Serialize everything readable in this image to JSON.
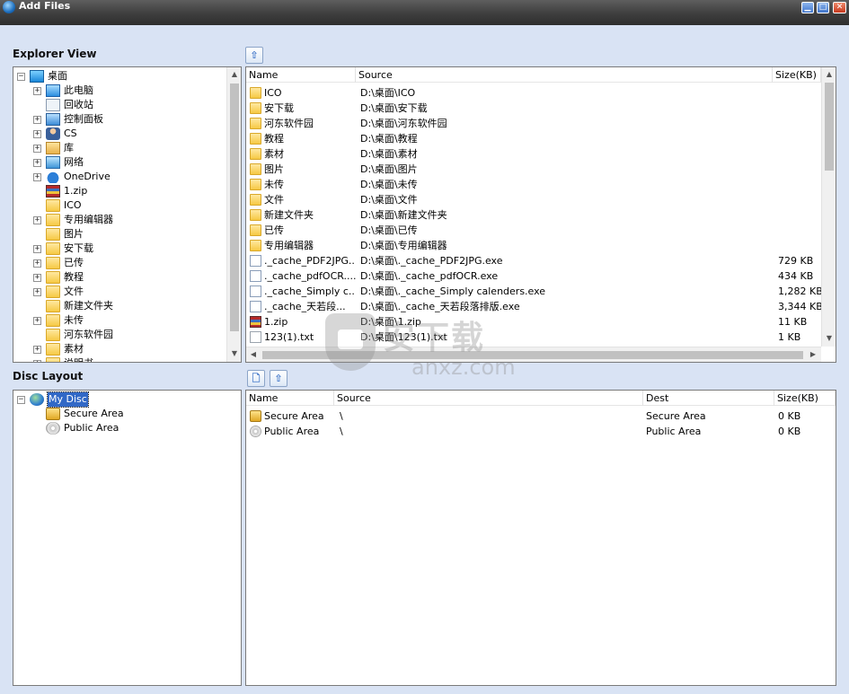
{
  "window": {
    "title": "Add Files"
  },
  "explorer": {
    "label": "Explorer View",
    "tree": [
      {
        "label": "桌面",
        "icon": "desktop-icon",
        "level": 0,
        "expander": "−"
      },
      {
        "label": "此电脑",
        "icon": "computer-icon",
        "level": 1,
        "expander": "+"
      },
      {
        "label": "回收站",
        "icon": "recycle-icon",
        "level": 1,
        "expander": ""
      },
      {
        "label": "控制面板",
        "icon": "control-panel-icon",
        "level": 1,
        "expander": "+"
      },
      {
        "label": "CS",
        "icon": "user-icon",
        "level": 1,
        "expander": "+"
      },
      {
        "label": "库",
        "icon": "library-icon",
        "level": 1,
        "expander": "+"
      },
      {
        "label": "网络",
        "icon": "network-icon",
        "level": 1,
        "expander": "+"
      },
      {
        "label": "OneDrive",
        "icon": "cloud-icon",
        "level": 1,
        "expander": "+"
      },
      {
        "label": "1.zip",
        "icon": "zip-icon",
        "level": 1,
        "expander": ""
      },
      {
        "label": "ICO",
        "icon": "folder-icon",
        "level": 1,
        "expander": ""
      },
      {
        "label": "专用编辑器",
        "icon": "folder-icon",
        "level": 1,
        "expander": "+"
      },
      {
        "label": "图片",
        "icon": "folder-icon",
        "level": 1,
        "expander": ""
      },
      {
        "label": "安下载",
        "icon": "folder-icon",
        "level": 1,
        "expander": "+"
      },
      {
        "label": "已传",
        "icon": "folder-icon",
        "level": 1,
        "expander": "+"
      },
      {
        "label": "教程",
        "icon": "folder-icon",
        "level": 1,
        "expander": "+"
      },
      {
        "label": "文件",
        "icon": "folder-icon",
        "level": 1,
        "expander": "+"
      },
      {
        "label": "新建文件夹",
        "icon": "folder-icon",
        "level": 1,
        "expander": ""
      },
      {
        "label": "未传",
        "icon": "folder-icon",
        "level": 1,
        "expander": "+"
      },
      {
        "label": "河东软件园",
        "icon": "folder-icon",
        "level": 1,
        "expander": ""
      },
      {
        "label": "素材",
        "icon": "folder-icon",
        "level": 1,
        "expander": "+"
      },
      {
        "label": "说明书",
        "icon": "folder-icon",
        "level": 1,
        "expander": "+"
      }
    ],
    "columns": {
      "name": "Name",
      "source": "Source",
      "size": "Size(KB)"
    },
    "rows": [
      {
        "name": "ICO",
        "source": "D:\\桌面\\ICO",
        "size": "",
        "icon": "folder-icon"
      },
      {
        "name": "安下载",
        "source": "D:\\桌面\\安下载",
        "size": "",
        "icon": "folder-icon"
      },
      {
        "name": "河东软件园",
        "source": "D:\\桌面\\河东软件园",
        "size": "",
        "icon": "folder-icon"
      },
      {
        "name": "教程",
        "source": "D:\\桌面\\教程",
        "size": "",
        "icon": "folder-icon"
      },
      {
        "name": "素材",
        "source": "D:\\桌面\\素材",
        "size": "",
        "icon": "folder-icon"
      },
      {
        "name": "图片",
        "source": "D:\\桌面\\图片",
        "size": "",
        "icon": "folder-icon"
      },
      {
        "name": "未传",
        "source": "D:\\桌面\\未传",
        "size": "",
        "icon": "folder-icon"
      },
      {
        "name": "文件",
        "source": "D:\\桌面\\文件",
        "size": "",
        "icon": "folder-icon"
      },
      {
        "name": "新建文件夹",
        "source": "D:\\桌面\\新建文件夹",
        "size": "",
        "icon": "folder-icon"
      },
      {
        "name": "已传",
        "source": "D:\\桌面\\已传",
        "size": "",
        "icon": "folder-icon"
      },
      {
        "name": "专用编辑器",
        "source": "D:\\桌面\\专用编辑器",
        "size": "",
        "icon": "folder-icon"
      },
      {
        "name": "._cache_PDF2JPG...",
        "source": "D:\\桌面\\._cache_PDF2JPG.exe",
        "size": "729 KB",
        "icon": "exe-icon"
      },
      {
        "name": "._cache_pdfOCR....",
        "source": "D:\\桌面\\._cache_pdfOCR.exe",
        "size": "434 KB",
        "icon": "exe-icon"
      },
      {
        "name": "._cache_Simply c...",
        "source": "D:\\桌面\\._cache_Simply calenders.exe",
        "size": "1,282 KB",
        "icon": "exe-icon"
      },
      {
        "name": "._cache_天若段...",
        "source": "D:\\桌面\\._cache_天若段落排版.exe",
        "size": "3,344 KB",
        "icon": "exe-icon"
      },
      {
        "name": "1.zip",
        "source": "D:\\桌面\\1.zip",
        "size": "11 KB",
        "icon": "zip-icon"
      },
      {
        "name": "123(1).txt",
        "source": "D:\\桌面\\123(1).txt",
        "size": "1 KB",
        "icon": "txt-icon"
      }
    ]
  },
  "disc": {
    "label": "Disc Layout",
    "tree": [
      {
        "label": "My Disc",
        "icon": "globe-icon",
        "level": 0,
        "expander": "−",
        "selected": true
      },
      {
        "label": "Secure Area",
        "icon": "lock-icon",
        "level": 1,
        "expander": ""
      },
      {
        "label": "Public Area",
        "icon": "disc-icon",
        "level": 1,
        "expander": ""
      }
    ],
    "columns": {
      "name": "Name",
      "source": "Source",
      "dest": "Dest",
      "size": "Size(KB)"
    },
    "rows": [
      {
        "name": "Secure Area",
        "source": "\\",
        "dest": "Secure Area",
        "size": "0 KB",
        "icon": "lock-icon"
      },
      {
        "name": "Public Area",
        "source": "\\",
        "dest": "Public Area",
        "size": "0 KB",
        "icon": "disc-icon"
      }
    ]
  },
  "watermark": {
    "cn": "安下载",
    "en": "anxz.com"
  }
}
